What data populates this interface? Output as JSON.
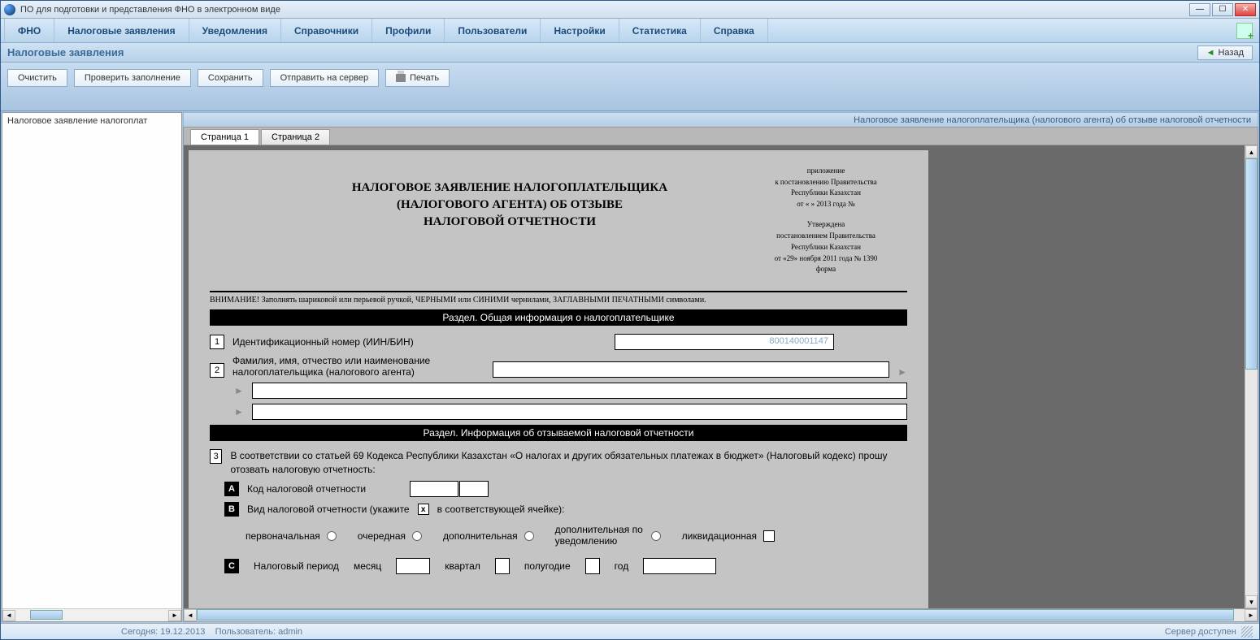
{
  "window": {
    "title": "ПО для подготовки и представления ФНО в электронном виде"
  },
  "menu": {
    "items": [
      "ФНО",
      "Налоговые заявления",
      "Уведомления",
      "Справочники",
      "Профили",
      "Пользователи",
      "Настройки",
      "Статистика",
      "Справка"
    ]
  },
  "subheader": {
    "title": "Налоговые заявления",
    "back": "Назад"
  },
  "toolbar": {
    "clear": "Очистить",
    "check": "Проверить заполнение",
    "save": "Сохранить",
    "send": "Отправить на сервер",
    "print": "Печать"
  },
  "tree": {
    "root": "Налоговое заявление налогоплат"
  },
  "doc": {
    "header": "Налоговое заявление налогоплательщика (налогового агента) об отзыве налоговой отчетности",
    "tabs": [
      "Страница 1",
      "Страница 2"
    ],
    "title_line1": "НАЛОГОВОЕ ЗАЯВЛЕНИЕ НАЛОГОПЛАТЕЛЬЩИКА",
    "title_line2": "(НАЛОГОВОГО АГЕНТА) ОБ ОТЗЫВЕ",
    "title_line3": "НАЛОГОВОЙ ОТЧЕТНОСТИ",
    "appendix": {
      "l1": "приложение",
      "l2": "к постановлению Правительства",
      "l3": "Республики Казахстан",
      "l4": "от «    »            2013 года №",
      "l5": "Утверждена",
      "l6": "постановлением Правительства",
      "l7": "Республики Казахстан",
      "l8": "от «29» ноября 2011 года № 1390",
      "l9": "форма"
    },
    "warning": "ВНИМАНИЕ! Заполнять шариковой или перьевой ручкой, ЧЕРНЫМИ или СИНИМИ чернилами, ЗАГЛАВНЫМИ ПЕЧАТНЫМИ символами.",
    "section1": "Раздел. Общая информация о налогоплательщике",
    "section2": "Раздел. Информация об отзываемой налоговой отчетности",
    "row1_num": "1",
    "row1_label": "Идентификационный номер (ИИН/БИН)",
    "row1_value": "800140001147",
    "row2_num": "2",
    "row2_label1": "Фамилия, имя, отчество или наименование",
    "row2_label2": "налогоплательщика (налогового агента)",
    "row3_num": "3",
    "row3_text": "В соответствии со статьей 69 Кодекса Республики Казахстан «О налогах и других обязательных платежах в бюджет» (Налоговый кодекс) прошу отозвать налоговую отчетность:",
    "rowA": "A",
    "rowA_label": "Код налоговой отчетности",
    "rowB": "B",
    "rowB_label": "Вид налоговой отчетности (укажите",
    "rowB_label2": "в соответствующей ячейке):",
    "rowB_x": "x",
    "opts": {
      "o1": "первоначальная",
      "o2": "очередная",
      "o3": "дополнительная",
      "o4": "дополнительная по уведомлению",
      "o5": "ликвидационная"
    },
    "rowC": "C",
    "rowC_label": "Налоговый период",
    "period": {
      "month": "месяц",
      "quarter": "квартал",
      "half": "полугодие",
      "year": "год"
    }
  },
  "status": {
    "date_label": "Сегодня:",
    "date": "19.12.2013",
    "user_label": "Пользователь:",
    "user": "admin",
    "server": "Сервер доступен"
  }
}
